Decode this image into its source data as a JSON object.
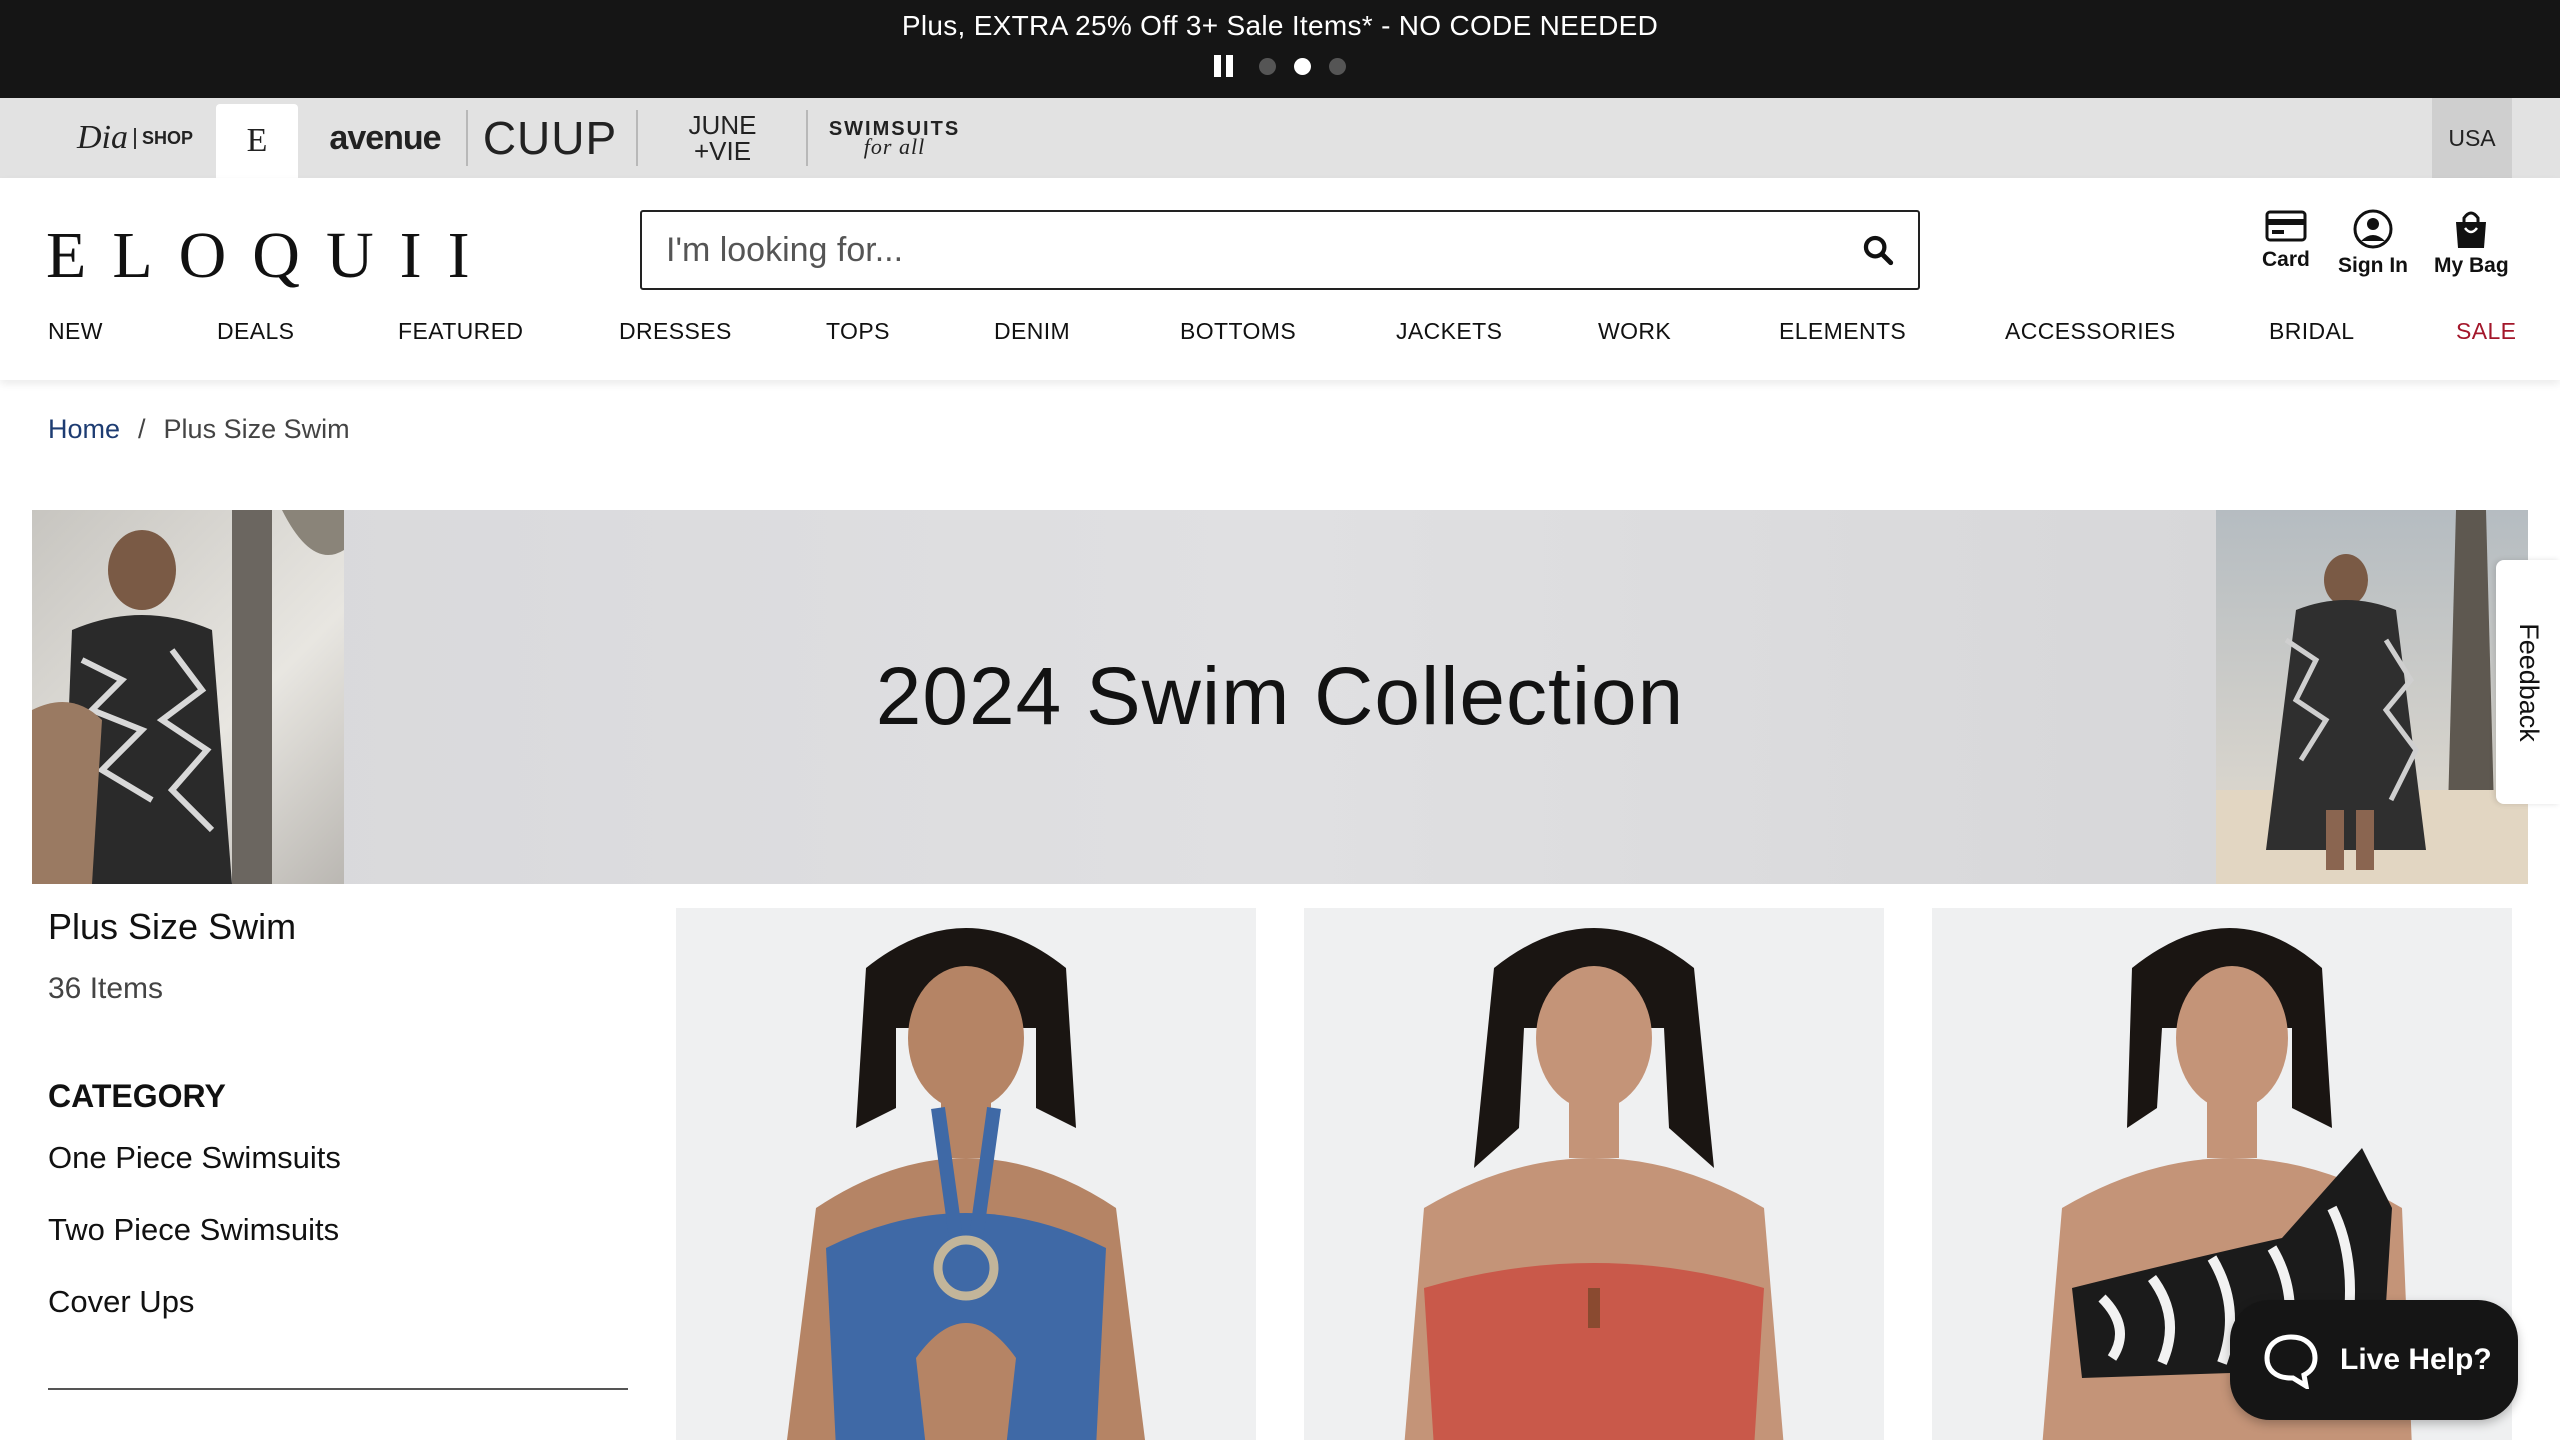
{
  "promo": {
    "text": "Plus, EXTRA 25% Off 3+ Sale Items* - NO CODE NEEDED",
    "slides": 3,
    "active_slide": 2
  },
  "brands": {
    "dia": "Dia",
    "dia_shop": "SHOP",
    "eloquii_short": "E",
    "avenue": "avenue",
    "cuup": "CUUP",
    "june_line1": "JUNE",
    "june_line2": "+VIE",
    "swim_line1": "SWIMSUITS",
    "swim_line2": "for all",
    "country": "USA"
  },
  "header": {
    "logo": "ELOQUII",
    "search_placeholder": "I'm looking for...",
    "card_label": "Card",
    "signin_label": "Sign In",
    "bag_label": "My Bag"
  },
  "nav": [
    "NEW",
    "DEALS",
    "FEATURED",
    "DRESSES",
    "TOPS",
    "DENIM",
    "BOTTOMS",
    "JACKETS",
    "WORK",
    "ELEMENTS",
    "ACCESSORIES",
    "BRIDAL",
    "SALE"
  ],
  "breadcrumb": {
    "home": "Home",
    "separator": "/",
    "current": "Plus Size Swim"
  },
  "banner": {
    "title": "2024 Swim Collection"
  },
  "feedback": "Feedback",
  "sidebar": {
    "title": "Plus Size Swim",
    "count": "36 Items",
    "category_heading": "CATEGORY",
    "categories": [
      "One Piece Swimsuits",
      "Two Piece Swimsuits",
      "Cover Ups"
    ]
  },
  "products": [
    {
      "swimsuit_color": "#3f69a6"
    },
    {
      "swimsuit_color": "#c9594a"
    },
    {
      "swimsuit_color": "#1b1b1b"
    }
  ],
  "live_help": "Live Help?"
}
